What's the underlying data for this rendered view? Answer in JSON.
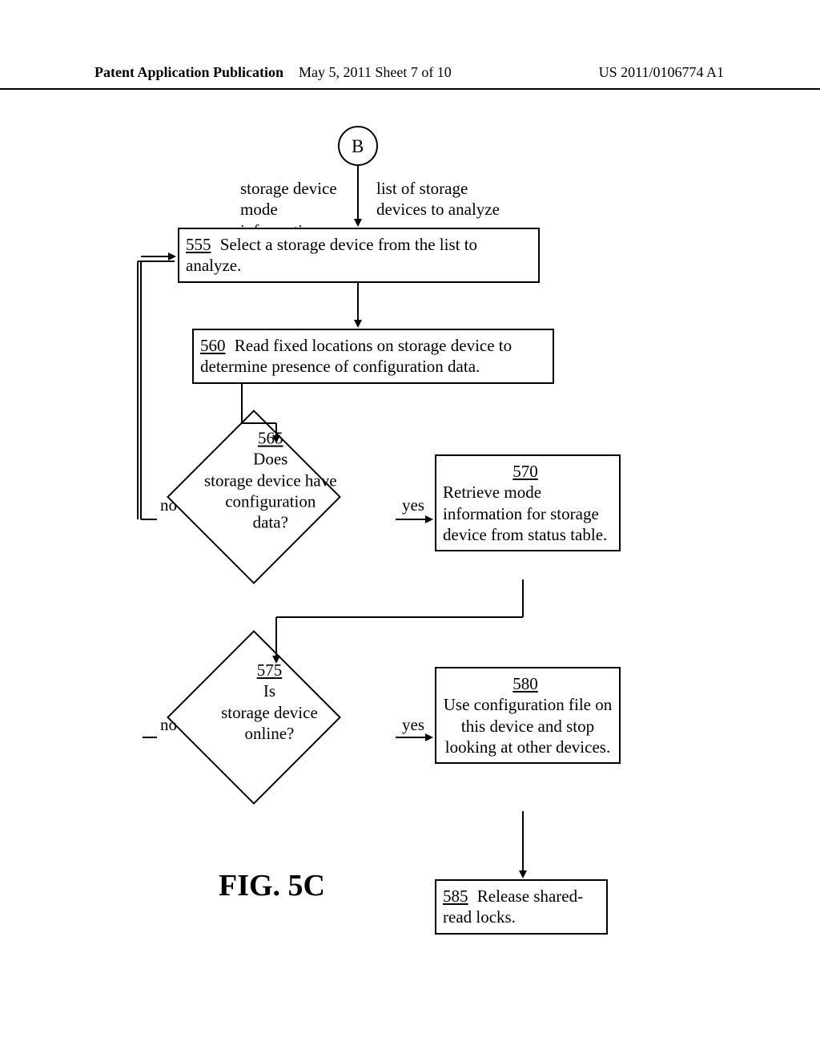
{
  "header": {
    "left": "Patent Application Publication",
    "mid": "May 5, 2011  Sheet 7 of 10",
    "right": "US 2011/0106774 A1"
  },
  "connector_b": "B",
  "label_left_in": "storage device\nmode information",
  "label_right_in": "list of storage\ndevices to analyze",
  "step555": {
    "ref": "555",
    "text": "Select a storage device from the list to analyze."
  },
  "step560": {
    "ref": "560",
    "text": "Read fixed locations on storage device to determine presence of configuration data."
  },
  "dec565": {
    "ref": "565",
    "text": "Does\nstorage device have\nconfiguration\ndata?"
  },
  "step570": {
    "ref": "570",
    "text": "Retrieve mode information for storage device from status table."
  },
  "dec575": {
    "ref": "575",
    "text": "Is\nstorage device\nonline?"
  },
  "step580": {
    "ref": "580",
    "text": "Use configuration file on this device and stop looking at other devices."
  },
  "step585": {
    "ref": "585",
    "text": "Release shared-read locks."
  },
  "yes565": "yes",
  "no565": "no",
  "yes575": "yes",
  "no575": "no",
  "figure": "FIG. 5C"
}
